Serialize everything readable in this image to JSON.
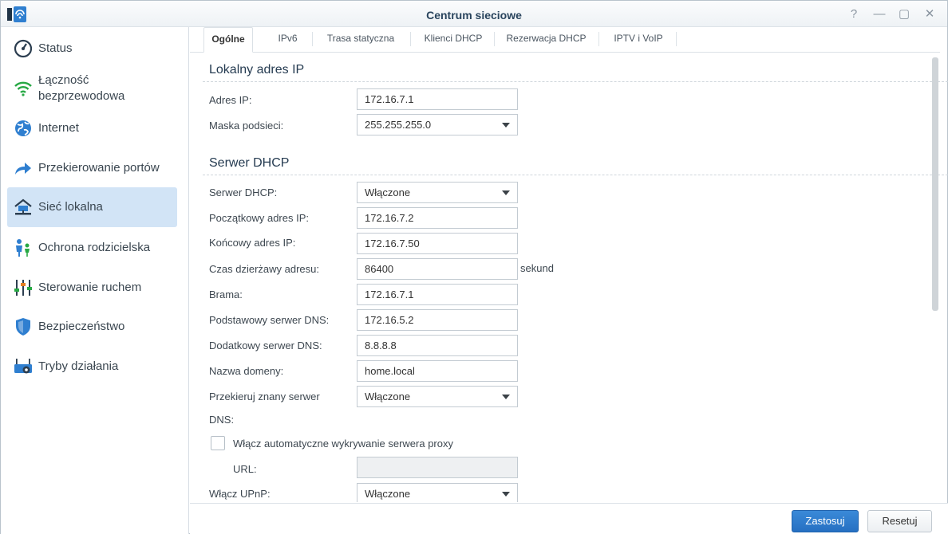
{
  "window": {
    "title": "Centrum sieciowe",
    "controls": [
      "?",
      "—",
      "▢",
      "✕"
    ]
  },
  "sidebar": {
    "items": [
      {
        "label": "Status",
        "icon": "gauge-icon"
      },
      {
        "label": "Łączność bezprzewodowa",
        "icon": "wifi-icon"
      },
      {
        "label": "Internet",
        "icon": "globe-icon"
      },
      {
        "label": "Przekierowanie portów",
        "icon": "arrow-forward-icon"
      },
      {
        "label": "Sieć lokalna",
        "icon": "home-network-icon",
        "active": true
      },
      {
        "label": "Ochrona rodzicielska",
        "icon": "family-icon"
      },
      {
        "label": "Sterowanie ruchem",
        "icon": "sliders-icon"
      },
      {
        "label": "Bezpieczeństwo",
        "icon": "shield-icon"
      },
      {
        "label": "Tryby działania",
        "icon": "router-gear-icon"
      }
    ]
  },
  "tabs": [
    {
      "label": "Ogólne",
      "active": true
    },
    {
      "label": "IPv6"
    },
    {
      "label": "Trasa statyczna"
    },
    {
      "label": "Klienci DHCP"
    },
    {
      "label": "Rezerwacja DHCP"
    },
    {
      "label": "IPTV i VoIP"
    }
  ],
  "local_ip": {
    "title": "Lokalny adres IP",
    "ip_label": "Adres IP:",
    "ip_value": "172.16.7.1",
    "mask_label": "Maska podsieci:",
    "mask_value": "255.255.255.0"
  },
  "dhcp": {
    "title": "Serwer DHCP",
    "server_label": "Serwer DHCP:",
    "server_value": "Włączone",
    "start_label": "Początkowy adres IP:",
    "start_value": "172.16.7.2",
    "end_label": "Końcowy adres IP:",
    "end_value": "172.16.7.50",
    "lease_label": "Czas dzierżawy adresu:",
    "lease_value": "86400",
    "lease_unit": "sekund",
    "gateway_label": "Brama:",
    "gateway_value": "172.16.7.1",
    "dns1_label": "Podstawowy serwer DNS:",
    "dns1_value": "172.16.5.2",
    "dns2_label": "Dodatkowy serwer DNS:",
    "dns2_value": "8.8.8.8",
    "domain_label": "Nazwa domeny:",
    "domain_value": "home.local",
    "forward_dns_label_1": "Przekieruj znany serwer",
    "forward_dns_label_2": "DNS:",
    "forward_dns_value": "Włączone",
    "proxy_label": "Włącz automatyczne wykrywanie serwera proxy",
    "proxy_checked": false,
    "url_label": "URL:",
    "url_value": "",
    "upnp_label": "Włącz UPnP:",
    "upnp_value": "Włączone"
  },
  "footer": {
    "apply_label": "Zastosuj",
    "reset_label": "Resetuj"
  },
  "colors": {
    "accent": "#2670c2",
    "active_nav": "#d2e4f6",
    "title_text": "#29445d"
  }
}
